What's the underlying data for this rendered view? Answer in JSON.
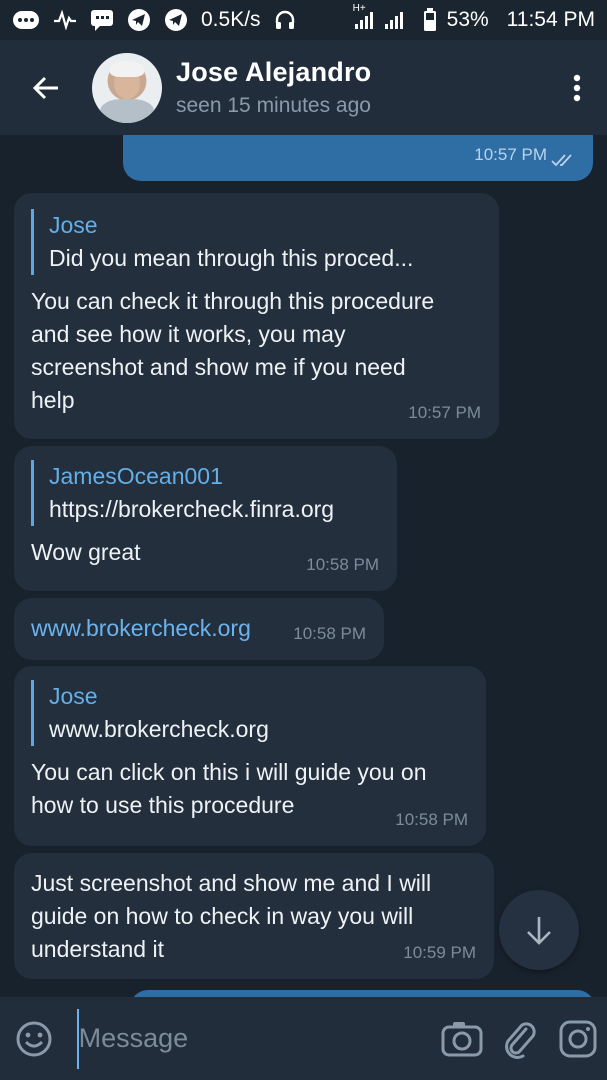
{
  "status_bar": {
    "speed": "0.5K/s",
    "network": "H+",
    "battery": "53%",
    "time": "11:54 PM",
    "icons": [
      "messenger-icon",
      "activity-icon",
      "chat-icon",
      "telegram-icon",
      "telegram-icon",
      "headphones-icon",
      "signal-icon",
      "battery-icon"
    ]
  },
  "header": {
    "name": "Jose Alejandro",
    "status": "seen 15 minutes ago"
  },
  "messages": [
    {
      "direction": "out",
      "time": "10:57 PM",
      "read": true
    },
    {
      "direction": "in",
      "reply_name": "Jose",
      "reply_text": "Did you mean through this proced...",
      "text": "You can check it through this procedure\nand see how it works, you may\nscreenshot and show me if you need\nhelp",
      "time": "10:57 PM"
    },
    {
      "direction": "in",
      "reply_name": "JamesOcean001",
      "reply_text": "https://brokercheck.finra.org",
      "text": "Wow great",
      "time": "10:58 PM"
    },
    {
      "direction": "in",
      "link": "www.brokercheck.org",
      "time": "10:58 PM"
    },
    {
      "direction": "in",
      "reply_name": "Jose",
      "reply_text": "www.brokercheck.org",
      "text": "You can click on this i will guide you on\nhow to use this procedure",
      "time": "10:58 PM"
    },
    {
      "direction": "in",
      "text": "Just screenshot and show me and I will\nguide on how to check in way you will\nunderstand it",
      "time": "10:59 PM"
    }
  ],
  "input": {
    "placeholder": "Message"
  },
  "colors": {
    "background": "#18222d",
    "bubble_in": "#232f3d",
    "bubble_out": "#2f6ea5",
    "accent": "#65aee6",
    "header": "#212d3b"
  }
}
